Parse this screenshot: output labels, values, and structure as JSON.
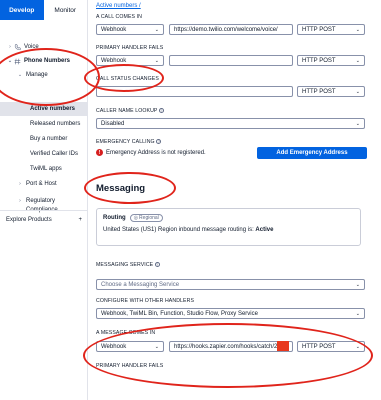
{
  "sidebar": {
    "tabs": [
      {
        "label": "Develop",
        "active": true
      },
      {
        "label": "Monitor",
        "active": false
      }
    ],
    "items": [
      {
        "label": "Voice",
        "level": 0,
        "chevron": "›"
      },
      {
        "label": "Phone Numbers",
        "level": 0,
        "chevron": "⌄"
      },
      {
        "label": "Manage",
        "level": 1,
        "chevron": "⌄"
      },
      {
        "label": "Active numbers",
        "level": 2,
        "active": true
      },
      {
        "label": "Released numbers",
        "level": 2
      },
      {
        "label": "Buy a number",
        "level": 2
      },
      {
        "label": "Verified Caller IDs",
        "level": 2
      },
      {
        "label": "TwiML apps",
        "level": 2
      },
      {
        "label": "Port & Host",
        "level": 1,
        "chevron": "›"
      },
      {
        "label": "Regulatory",
        "level": 1,
        "chevron": "›"
      },
      {
        "label": "Compliance",
        "level": 1
      }
    ],
    "explore_label": "Explore Products",
    "explore_add": "+"
  },
  "main": {
    "breadcrumb": "Active numbers /",
    "call_comes_in": {
      "label": "A CALL COMES IN",
      "type": "Webhook",
      "url": "https://demo.twilio.com/welcome/voice/",
      "method": "HTTP POST"
    },
    "primary_handler_fails": {
      "label": "PRIMARY HANDLER FAILS",
      "type": "Webhook",
      "url": "",
      "method": "HTTP POST"
    },
    "call_status_changes": {
      "label": "CALL STATUS CHANGES",
      "url": "",
      "method": "HTTP POST"
    },
    "caller_name_lookup": {
      "label": "CALLER NAME LOOKUP",
      "value": "Disabled"
    },
    "emergency": {
      "label": "EMERGENCY CALLING",
      "warning": "Emergency Address is not registered.",
      "button": "Add Emergency Address"
    },
    "messaging": {
      "title": "Messaging",
      "routing_label": "Routing",
      "routing_badge": "Regional",
      "routing_text_prefix": "United States (US1) Region inbound message routing is: ",
      "routing_text_status": "Active",
      "messaging_service_label": "MESSAGING SERVICE",
      "messaging_service_placeholder": "Choose a Messaging Service",
      "configure_label": "CONFIGURE WITH OTHER HANDLERS",
      "configure_value": "Webhook, TwiML Bin, Function, Studio Flow, Proxy Service",
      "message_comes_in": {
        "label": "A MESSAGE COMES IN",
        "type": "Webhook",
        "url": "https://hooks.zapier.com/hooks/catch/2",
        "method": "HTTP POST"
      },
      "primary_handler_fails_label": "PRIMARY HANDLER FAILS"
    }
  },
  "colors": {
    "accent": "#0263e0",
    "annotation": "#e0241b",
    "redaction": "#e8381d",
    "error": "#d61f1f"
  }
}
